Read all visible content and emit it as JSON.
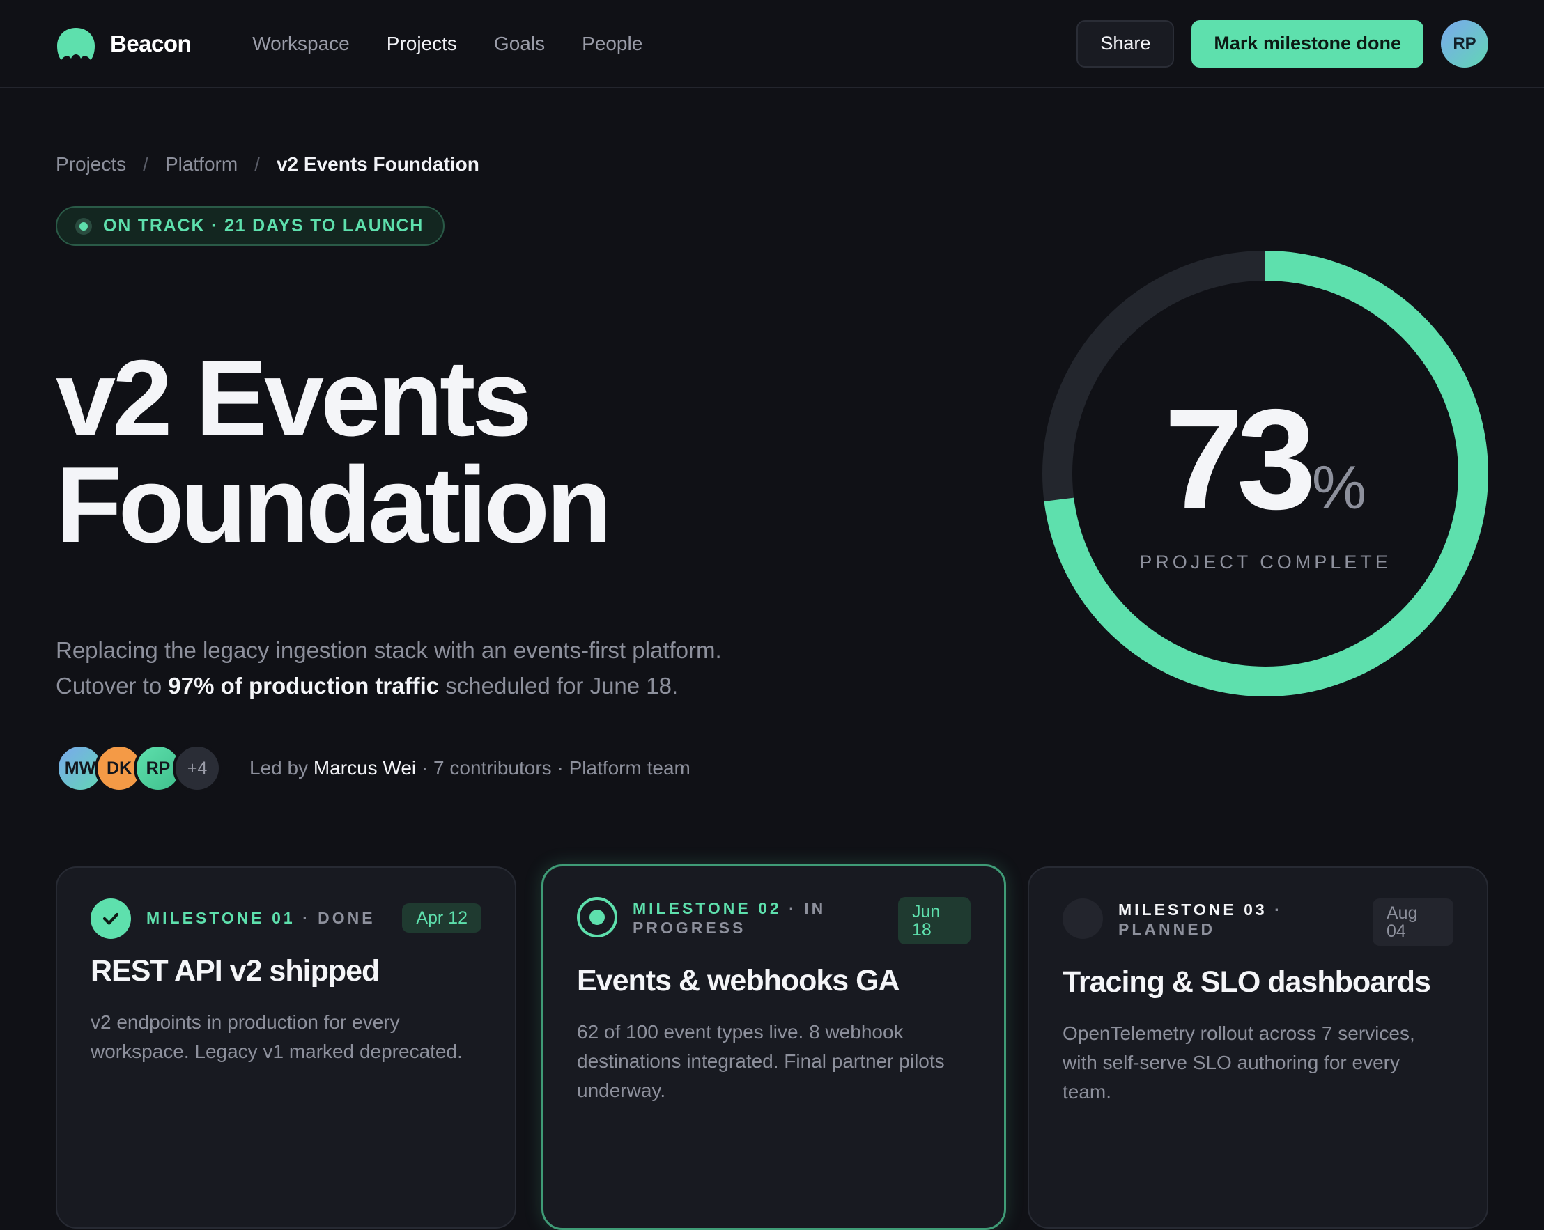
{
  "app": {
    "name": "Beacon"
  },
  "nav": {
    "items": [
      {
        "label": "Workspace",
        "active": false
      },
      {
        "label": "Projects",
        "active": true
      },
      {
        "label": "Goals",
        "active": false
      },
      {
        "label": "People",
        "active": false
      }
    ]
  },
  "actions": {
    "share_label": "Share",
    "primary_label": "Mark milestone done",
    "user_initials": "RP"
  },
  "breadcrumb": {
    "items": [
      "Projects",
      "Platform",
      "v2 Events Foundation"
    ],
    "separator": "/"
  },
  "status": {
    "text": "ON TRACK · 21 DAYS TO LAUNCH"
  },
  "hero": {
    "title_line1": "v2 Events",
    "title_line2": "Foundation",
    "desc_line1": "Replacing the legacy ingestion stack with an events-first platform.",
    "desc_pre": "Cutover to ",
    "desc_bold": "97% of production traffic",
    "desc_post": " scheduled for June 18."
  },
  "team": {
    "avatars": [
      "MW",
      "DK",
      "RP"
    ],
    "more": "+4",
    "led_by_prefix": "Led by ",
    "lead_name": "Marcus Wei",
    "meta": " · 7 contributors · Platform team"
  },
  "progress": {
    "value": 73,
    "unit": "%",
    "label": "PROJECT COMPLETE"
  },
  "milestones": [
    {
      "number": "MILESTONE 01",
      "state": " · DONE",
      "date": "Apr 12",
      "title": "REST API v2 shipped",
      "description": "v2 endpoints in production for every workspace. Legacy v1 marked deprecated."
    },
    {
      "number": "MILESTONE 02",
      "state": " · IN PROGRESS",
      "date": "Jun 18",
      "title": "Events & webhooks GA",
      "description": "62 of 100 event types live. 8 webhook destinations integrated. Final partner pilots underway."
    },
    {
      "number": "MILESTONE 03",
      "state": " · PLANNED",
      "date": "Aug 04",
      "title": "Tracing & SLO dashboards",
      "description": "OpenTelemetry rollout across 7 services, with self-serve SLO authoring for every team."
    }
  ],
  "colors": {
    "accent": "#5ee0ad",
    "background": "#101116",
    "card": "#181a21",
    "muted_text": "#8d909c"
  }
}
